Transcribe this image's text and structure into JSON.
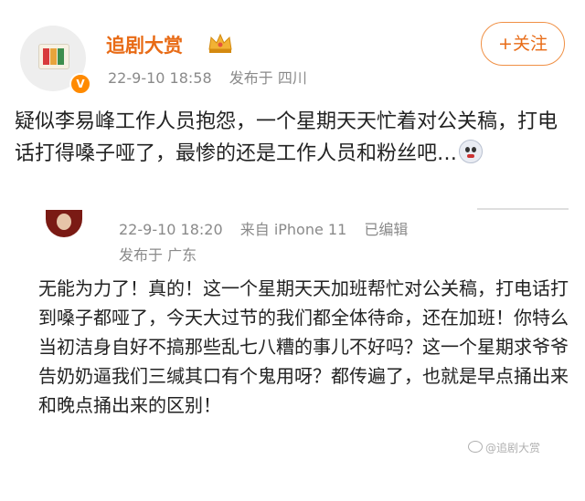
{
  "header": {
    "username": "追剧大赏",
    "timestamp": "22-9-10 18:58",
    "location": "发布于 四川",
    "follow_label": "+关注",
    "badge": "V"
  },
  "post": {
    "text": "疑似李易峰工作人员抱怨，一个星期天天忙着对公关稿，打电话打得嗓子哑了，最惨的还是工作人员和粉丝吧…"
  },
  "repost": {
    "timestamp": "22-9-10 18:20",
    "device": "来自 iPhone 11",
    "edited": "已编辑",
    "location": "发布于 广东",
    "text": "无能为力了！真的！这一个星期天天加班帮忙对公关稿，打电话打到嗓子都哑了，今天大过节的我们都全体待命，还在加班！你特么当初洁身自好不搞那些乱七八糟的事儿不好吗？这一个星期求爷爷告奶奶逼我们三缄其口有个鬼用呀？都传遍了，也就是早点捅出来和晚点捅出来的区别！"
  },
  "watermark": "@追剧大赏",
  "colors": {
    "accent": "#e86b16",
    "meta": "#8a8a8a"
  }
}
